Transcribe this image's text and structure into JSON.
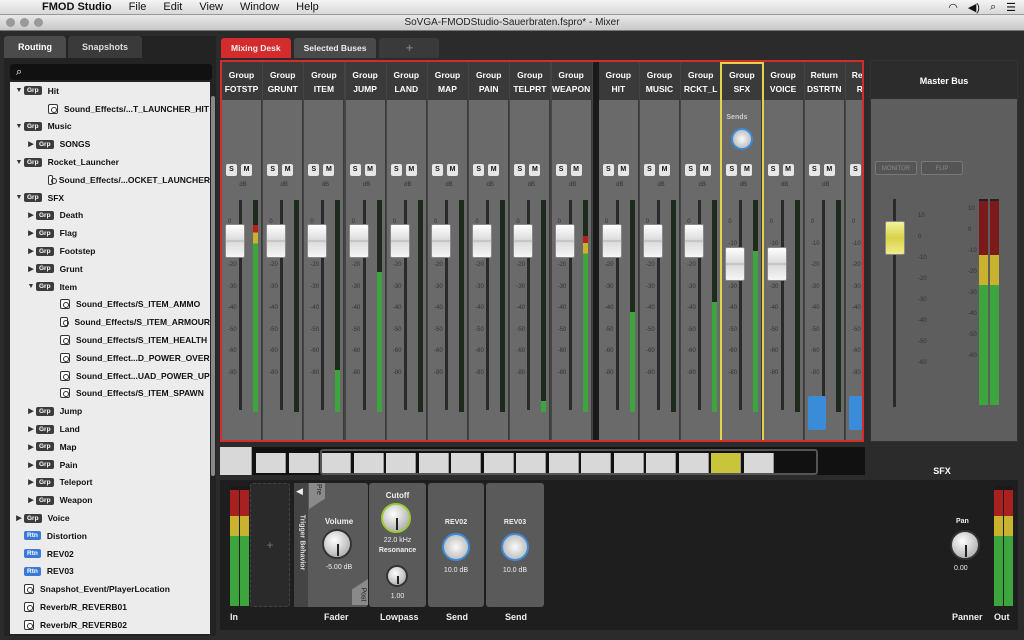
{
  "menubar": {
    "app": "FMOD Studio",
    "items": [
      "File",
      "Edit",
      "View",
      "Window",
      "Help"
    ]
  },
  "window": {
    "title": "SoVGA-FMODStudio-Sauerbraten.fspro* - Mixer"
  },
  "left_tabs": [
    "Routing",
    "Snapshots"
  ],
  "search": {
    "placeholder": ""
  },
  "tree": [
    {
      "level": 0,
      "twisty": "▼",
      "badge": "Grp",
      "kind": "grp",
      "label": "Hit"
    },
    {
      "level": 2,
      "twisty": "",
      "badge": "",
      "kind": "evt",
      "label": "Sound_Effects/...T_LAUNCHER_HIT"
    },
    {
      "level": 0,
      "twisty": "▼",
      "badge": "Grp",
      "kind": "grp",
      "label": "Music"
    },
    {
      "level": 1,
      "twisty": "▶",
      "badge": "Grp",
      "kind": "grp",
      "label": "SONGS"
    },
    {
      "level": 0,
      "twisty": "▼",
      "badge": "Grp",
      "kind": "grp",
      "label": "Rocket_Launcher"
    },
    {
      "level": 2,
      "twisty": "",
      "badge": "",
      "kind": "evt",
      "label": "Sound_Effects/...OCKET_LAUNCHER"
    },
    {
      "level": 0,
      "twisty": "▼",
      "badge": "Grp",
      "kind": "grp",
      "label": "SFX"
    },
    {
      "level": 1,
      "twisty": "▶",
      "badge": "Grp",
      "kind": "grp",
      "label": "Death"
    },
    {
      "level": 1,
      "twisty": "▶",
      "badge": "Grp",
      "kind": "grp",
      "label": "Flag"
    },
    {
      "level": 1,
      "twisty": "▶",
      "badge": "Grp",
      "kind": "grp",
      "label": "Footstep"
    },
    {
      "level": 1,
      "twisty": "▶",
      "badge": "Grp",
      "kind": "grp",
      "label": "Grunt"
    },
    {
      "level": 1,
      "twisty": "▼",
      "badge": "Grp",
      "kind": "grp",
      "label": "Item"
    },
    {
      "level": 3,
      "twisty": "",
      "badge": "",
      "kind": "evt",
      "label": "Sound_Effects/S_ITEM_AMMO"
    },
    {
      "level": 3,
      "twisty": "",
      "badge": "",
      "kind": "evt",
      "label": "Sound_Effects/S_ITEM_ARMOUR"
    },
    {
      "level": 3,
      "twisty": "",
      "badge": "",
      "kind": "evt",
      "label": "Sound_Effects/S_ITEM_HEALTH"
    },
    {
      "level": 3,
      "twisty": "",
      "badge": "",
      "kind": "evt",
      "label": "Sound_Effect...D_POWER_OVER"
    },
    {
      "level": 3,
      "twisty": "",
      "badge": "",
      "kind": "evt",
      "label": "Sound_Effect...UAD_POWER_UP"
    },
    {
      "level": 3,
      "twisty": "",
      "badge": "",
      "kind": "evt",
      "label": "Sound_Effects/S_ITEM_SPAWN"
    },
    {
      "level": 1,
      "twisty": "▶",
      "badge": "Grp",
      "kind": "grp",
      "label": "Jump"
    },
    {
      "level": 1,
      "twisty": "▶",
      "badge": "Grp",
      "kind": "grp",
      "label": "Land"
    },
    {
      "level": 1,
      "twisty": "▶",
      "badge": "Grp",
      "kind": "grp",
      "label": "Map"
    },
    {
      "level": 1,
      "twisty": "▶",
      "badge": "Grp",
      "kind": "grp",
      "label": "Pain"
    },
    {
      "level": 1,
      "twisty": "▶",
      "badge": "Grp",
      "kind": "grp",
      "label": "Teleport"
    },
    {
      "level": 1,
      "twisty": "▶",
      "badge": "Grp",
      "kind": "grp",
      "label": "Weapon"
    },
    {
      "level": 0,
      "twisty": "▶",
      "badge": "Grp",
      "kind": "grp",
      "label": "Voice"
    },
    {
      "level": 0,
      "twisty": "",
      "badge": "Rtn",
      "kind": "rtn",
      "label": "Distortion"
    },
    {
      "level": 0,
      "twisty": "",
      "badge": "Rtn",
      "kind": "rtn",
      "label": "REV02"
    },
    {
      "level": 0,
      "twisty": "",
      "badge": "Rtn",
      "kind": "rtn",
      "label": "REV03"
    },
    {
      "level": 0,
      "twisty": "",
      "badge": "",
      "kind": "evt",
      "label": "Snapshot_Event/PlayerLocation"
    },
    {
      "level": 0,
      "twisty": "",
      "badge": "",
      "kind": "evt",
      "label": "Reverb/R_REVERB01"
    },
    {
      "level": 0,
      "twisty": "",
      "badge": "",
      "kind": "evt",
      "label": "Reverb/R_REVERB02"
    }
  ],
  "mixer_tabs": [
    "Mixing Desk",
    "Selected Buses",
    "+"
  ],
  "strips": [
    {
      "type": "Group",
      "name": "FOTSTP",
      "level": 0.0,
      "meter": 0.88
    },
    {
      "type": "Group",
      "name": "GRUNT",
      "level": 0.0,
      "meter": 0.0
    },
    {
      "type": "Group",
      "name": "ITEM",
      "level": 0.0,
      "meter": 0.2
    },
    {
      "type": "Group",
      "name": "JUMP",
      "level": 0.0,
      "meter": 0.66
    },
    {
      "type": "Group",
      "name": "LAND",
      "level": 0.0,
      "meter": 0.0
    },
    {
      "type": "Group",
      "name": "MAP",
      "level": 0.0,
      "meter": 0.0
    },
    {
      "type": "Group",
      "name": "PAIN",
      "level": 0.0,
      "meter": 0.0
    },
    {
      "type": "Group",
      "name": "TELPRT",
      "level": 0.0,
      "meter": 0.05
    },
    {
      "type": "Group",
      "name": "WEAPON",
      "level": 0.0,
      "meter": 0.83
    },
    {
      "type": "Group",
      "name": "HIT",
      "level": 0.0,
      "meter": 0.47
    },
    {
      "type": "Group",
      "name": "MUSIC",
      "level": 0.0,
      "meter": 0.0
    },
    {
      "type": "Group",
      "name": "RCKT_L",
      "level": 0.0,
      "meter": 0.52
    },
    {
      "type": "Group",
      "name": "SFX",
      "level": -5.0,
      "meter": 0.76
    },
    {
      "type": "Group",
      "name": "VOICE",
      "level": -5.0,
      "meter": 0.0
    },
    {
      "type": "Return",
      "name": "DSTRTN",
      "level": -80,
      "meter": 0.0
    },
    {
      "type": "Return",
      "name": "REV",
      "level": -80,
      "meter": 0.0
    }
  ],
  "strip_buttons": {
    "solo": "S",
    "mute": "M"
  },
  "db_label": "dB",
  "db_scale": [
    "10",
    "0",
    "-10",
    "-20",
    "-30",
    "-40",
    "-50",
    "-60",
    "-80"
  ],
  "sends_label": "Sends",
  "master": {
    "title": "Master Bus",
    "monitor": "MONITOR",
    "flip": "FLIP"
  },
  "deck": {
    "title": "SFX",
    "trigger": "Trigger Behavior",
    "pre": "Pre",
    "post": "Post",
    "fader": {
      "label": "Volume",
      "value": "-5.00 dB",
      "name": "Fader"
    },
    "lowpass": {
      "cutoff_label": "Cutoff",
      "cutoff": "22.0 kHz",
      "res_label": "Resonance",
      "res": "1.00",
      "name": "Lowpass"
    },
    "send1": {
      "label": "REV02",
      "value": "10.0 dB",
      "name": "Send"
    },
    "send2": {
      "label": "REV03",
      "value": "10.0 dB",
      "name": "Send"
    },
    "panner": {
      "label": "Pan",
      "value": "0.00",
      "name": "Panner"
    },
    "in": "In",
    "out": "Out",
    "add": "+"
  },
  "colors": {
    "accent": "#d42c2c",
    "selected": "#e2d34a",
    "send": "#3a8bd8",
    "meter": "#3da53d"
  }
}
